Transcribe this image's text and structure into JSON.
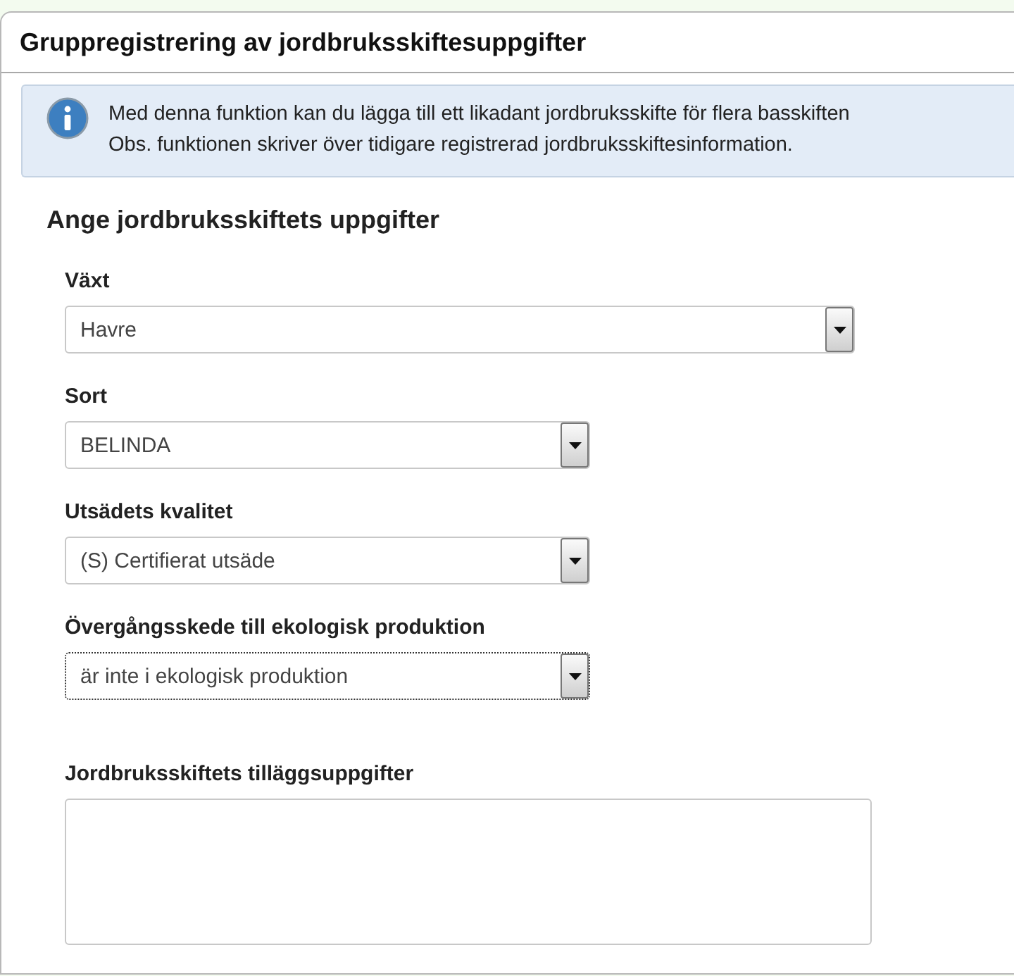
{
  "panel": {
    "title": "Gruppregistrering av jordbruksskiftesuppgifter"
  },
  "info": {
    "lines": [
      "Med denna funktion kan du lägga till ett likadant jordbruksskifte för flera basskiften",
      "Obs. funktionen skriver över tidigare registrerad jordbruksskiftesinformation."
    ]
  },
  "section": {
    "title": "Ange jordbruksskiftets uppgifter"
  },
  "fields": [
    {
      "kind": "select",
      "label": "Växt",
      "value": "Havre",
      "wide": true,
      "focused": false
    },
    {
      "kind": "select",
      "label": "Sort",
      "value": "BELINDA",
      "wide": false,
      "focused": false
    },
    {
      "kind": "select",
      "label": "Utsädets kvalitet",
      "value": "(S) Certifierat utsäde",
      "wide": false,
      "focused": false
    },
    {
      "kind": "select",
      "label": "Övergångsskede till ekologisk produktion",
      "value": "är inte i ekologisk produktion",
      "wide": false,
      "focused": true
    },
    {
      "kind": "textarea",
      "label": "Jordbruksskiftets tilläggsuppgifter"
    }
  ]
}
